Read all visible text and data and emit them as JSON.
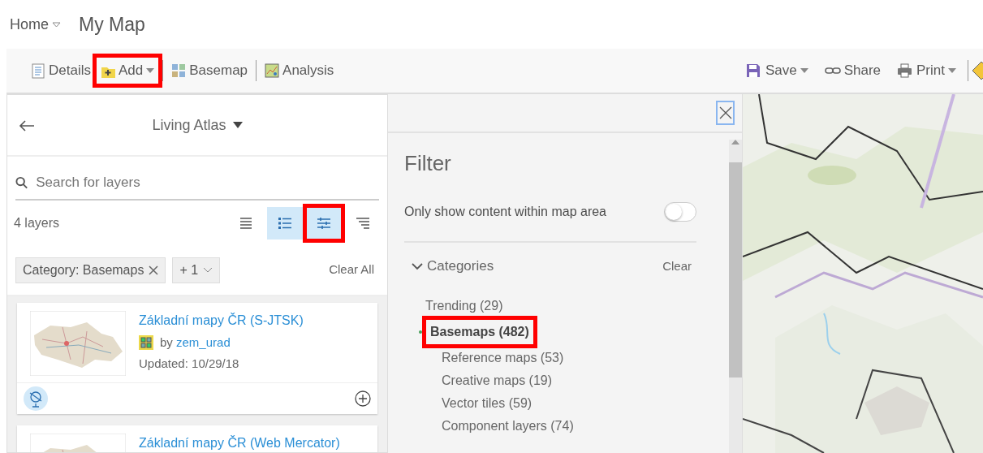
{
  "header": {
    "home": "Home",
    "title": "My Map"
  },
  "toolbar": {
    "left": [
      {
        "label": "Details",
        "kind": "details",
        "caret": false,
        "highlighted": false
      },
      {
        "label": "Add",
        "kind": "add",
        "caret": true,
        "highlighted": true
      },
      {
        "label": "Basemap",
        "kind": "basemap",
        "caret": false,
        "highlighted": false
      },
      {
        "label": "Analysis",
        "kind": "analysis",
        "caret": false,
        "highlighted": false
      }
    ],
    "right": [
      {
        "label": "Save",
        "kind": "save",
        "caret": true
      },
      {
        "label": "Share",
        "kind": "share",
        "caret": false
      },
      {
        "label": "Print",
        "kind": "print",
        "caret": true
      }
    ]
  },
  "browser": {
    "source": "Living Atlas",
    "search": {
      "placeholder": "Search for layers"
    },
    "count": "4 layers",
    "views": [
      {
        "kind": "list",
        "selected": false,
        "highlighted": false
      },
      {
        "kind": "detail",
        "selected": true,
        "highlighted": false
      },
      {
        "kind": "filter",
        "selected": true,
        "highlighted": true
      },
      {
        "kind": "sort",
        "selected": false,
        "highlighted": false
      }
    ],
    "chips": [
      {
        "label": "Category: Basemaps",
        "kind": "removable"
      },
      {
        "label": "+ 1",
        "kind": "dropdown"
      }
    ],
    "clear_all": "Clear All",
    "results": [
      {
        "title": "Základní mapy ČR (S-JTSK)",
        "by": "by",
        "owner": "zem_urad",
        "updated": "Updated: 10/29/18"
      },
      {
        "title": "Základní mapy ČR (Web Mercator)"
      }
    ]
  },
  "filter": {
    "title": "Filter",
    "map_area": {
      "label": "Only show content within map area",
      "on": false
    },
    "categories": {
      "label": "Categories",
      "expanded": true,
      "clear": "Clear",
      "items": [
        {
          "label": "Trending (29)",
          "selected": false,
          "highlighted": false
        },
        {
          "label": "Basemaps (482)",
          "selected": true,
          "highlighted": true,
          "children": [
            {
              "label": "Reference maps (53)",
              "selected": false
            },
            {
              "label": "Creative maps (19)",
              "selected": false
            },
            {
              "label": "Vector tiles (59)",
              "selected": false
            },
            {
              "label": "Component layers (74)",
              "selected": false
            }
          ]
        }
      ]
    }
  }
}
